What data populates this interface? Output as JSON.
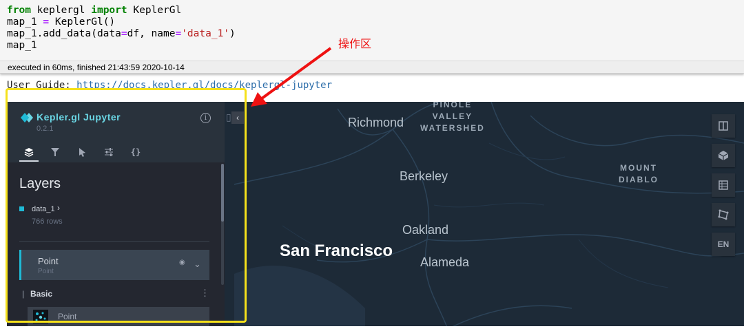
{
  "notebook": {
    "code_lines": [
      {
        "segments": [
          {
            "t": "from",
            "c": "kw"
          },
          {
            "t": " keplergl ",
            "c": ""
          },
          {
            "t": "import",
            "c": "kw"
          },
          {
            "t": " KeplerGl",
            "c": ""
          }
        ]
      },
      {
        "segments": [
          {
            "t": "map_1 ",
            "c": ""
          },
          {
            "t": "=",
            "c": "op"
          },
          {
            "t": " KeplerGl()",
            "c": ""
          }
        ]
      },
      {
        "segments": [
          {
            "t": "map_1.add_data(data",
            "c": ""
          },
          {
            "t": "=",
            "c": "op"
          },
          {
            "t": "df, name",
            "c": ""
          },
          {
            "t": "=",
            "c": "op"
          },
          {
            "t": "'data_1'",
            "c": "str"
          },
          {
            "t": ")",
            "c": ""
          }
        ]
      },
      {
        "segments": [
          {
            "t": "map_1",
            "c": ""
          }
        ]
      }
    ],
    "exec_status": "executed in 60ms, finished 21:43:59 2020-10-14",
    "user_guide_label": "User Guide: ",
    "user_guide_link": "https://docs.kepler.gl/docs/keplergl-jupyter"
  },
  "annotation": {
    "label": "操作区",
    "color": "#ee1111",
    "highlight_color": "#f5e11b"
  },
  "panel": {
    "title": "Kepler.gl Jupyter",
    "version": "0.2.1",
    "info_glyph": "i",
    "collapse_glyph": "‹",
    "tabs": [
      {
        "name": "layers",
        "icon": "layers-icon",
        "active": true
      },
      {
        "name": "filters",
        "icon": "filter-icon",
        "active": false
      },
      {
        "name": "interactions",
        "icon": "cursor-icon",
        "active": false
      },
      {
        "name": "base-map",
        "icon": "sliders-icon",
        "active": false
      },
      {
        "name": "config",
        "icon": "braces-icon",
        "active": false
      }
    ],
    "section_title": "Layers",
    "dataset": {
      "name": "data_1",
      "rows": "766 rows",
      "color": "#1fbad6"
    },
    "layer": {
      "name": "Point",
      "type": "Point"
    },
    "group": {
      "label": "Basic"
    },
    "layer_type_option": {
      "label": "Point"
    }
  },
  "map": {
    "places": {
      "richmond": "Richmond",
      "pinole": [
        "PINOLE",
        "VALLEY",
        "WATERSHED"
      ],
      "mount_diablo": [
        "MOUNT",
        "DIABLO"
      ],
      "berkeley": "Berkeley",
      "oakland": "Oakland",
      "san_francisco": "San Francisco",
      "alameda": "Alameda"
    },
    "controls": [
      {
        "name": "split-map",
        "icon": "split-map-icon"
      },
      {
        "name": "3d-view",
        "icon": "cube-icon"
      },
      {
        "name": "legend",
        "icon": "legend-icon"
      },
      {
        "name": "draw",
        "icon": "polygon-draw-icon"
      },
      {
        "name": "language",
        "label": "EN"
      }
    ]
  },
  "colors": {
    "map_bg": "#1d2a37",
    "panel_bg": "#242730",
    "accent": "#1fbad6"
  }
}
